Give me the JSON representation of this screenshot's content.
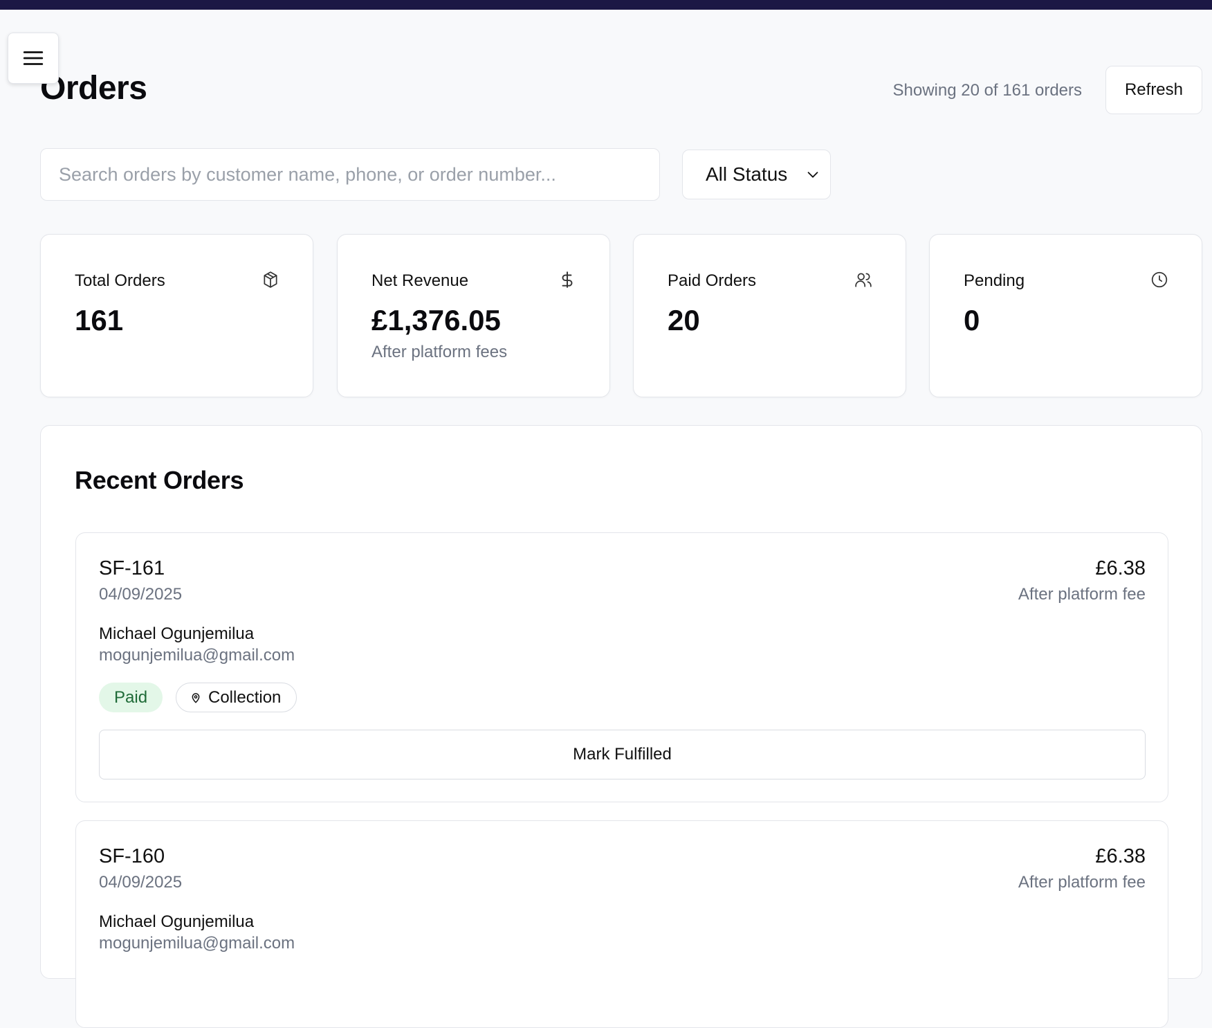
{
  "header": {
    "title": "Orders",
    "showing_text": "Showing 20 of 161 orders",
    "refresh_label": "Refresh"
  },
  "filters": {
    "search_placeholder": "Search orders by customer name, phone, or order number...",
    "status_selected": "All Status"
  },
  "stats": [
    {
      "label": "Total Orders",
      "value": "161",
      "sub": "",
      "icon": "package-icon"
    },
    {
      "label": "Net Revenue",
      "value": "£1,376.05",
      "sub": "After platform fees",
      "icon": "dollar-icon"
    },
    {
      "label": "Paid Orders",
      "value": "20",
      "sub": "",
      "icon": "users-icon"
    },
    {
      "label": "Pending",
      "value": "0",
      "sub": "",
      "icon": "clock-icon"
    }
  ],
  "recent": {
    "title": "Recent Orders",
    "orders": [
      {
        "id": "SF-161",
        "date": "04/09/2025",
        "amount": "£6.38",
        "amount_note": "After platform fee",
        "customer_name": "Michael Ogunjemilua",
        "customer_email": "mogunjemilua@gmail.com",
        "status_badge": "Paid",
        "fulfilment_badge": "Collection",
        "action_label": "Mark Fulfilled"
      },
      {
        "id": "SF-160",
        "date": "04/09/2025",
        "amount": "£6.38",
        "amount_note": "After platform fee",
        "customer_name": "Michael Ogunjemilua",
        "customer_email": "mogunjemilua@gmail.com"
      }
    ]
  },
  "colors": {
    "topbar": "#1c1845",
    "paid_badge_bg": "#e3f7e8",
    "paid_badge_text": "#1f6b38",
    "muted_text": "#6b7280"
  }
}
